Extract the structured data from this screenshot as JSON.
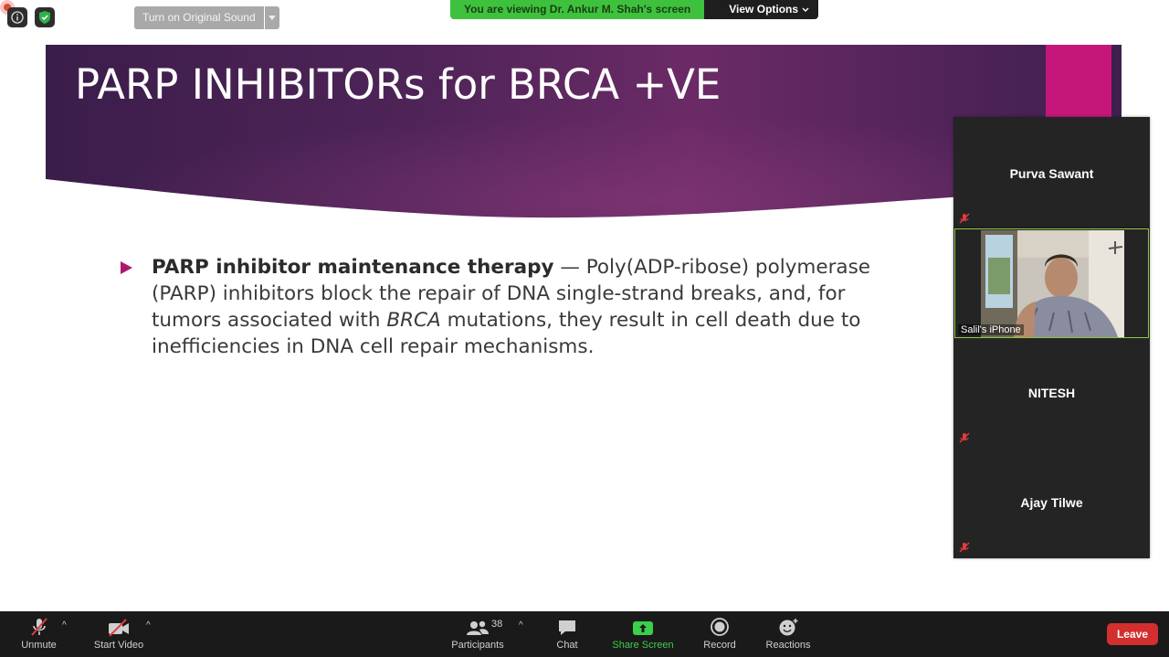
{
  "top_bar": {
    "original_sound_label": "Turn on Original Sound",
    "viewing_text": "You are viewing Dr. Ankur M. Shah's screen",
    "view_options_label": "View Options"
  },
  "slide": {
    "title": "PARP INHIBITORs for BRCA +VE",
    "bullet_bold": "PARP inhibitor maintenance therapy",
    "bullet_text_1": " — Poly(ADP-ribose) polymerase (PARP) inhibitors block the repair of DNA single-strand breaks, and, for tumors associated with ",
    "bullet_italic": "BRCA",
    "bullet_text_2": " mutations, they result in cell death due to inefficiencies in DNA cell repair mechanisms.",
    "accent_color": "#b0186c"
  },
  "participants_panel": {
    "tiles": [
      {
        "name": "Purva Sawant",
        "muted": true
      },
      {
        "name": "Salil's iPhone",
        "video": true
      },
      {
        "name": "NITESH",
        "muted": true
      },
      {
        "name": "Ajay Tilwe",
        "muted": true
      }
    ]
  },
  "toolbar": {
    "unmute_label": "Unmute",
    "start_video_label": "Start Video",
    "participants_label": "Participants",
    "participants_count": "38",
    "chat_label": "Chat",
    "share_screen_label": "Share Screen",
    "record_label": "Record",
    "reactions_label": "Reactions",
    "leave_label": "Leave",
    "share_color": "#3ad04a",
    "leave_color": "#d32f2f"
  }
}
